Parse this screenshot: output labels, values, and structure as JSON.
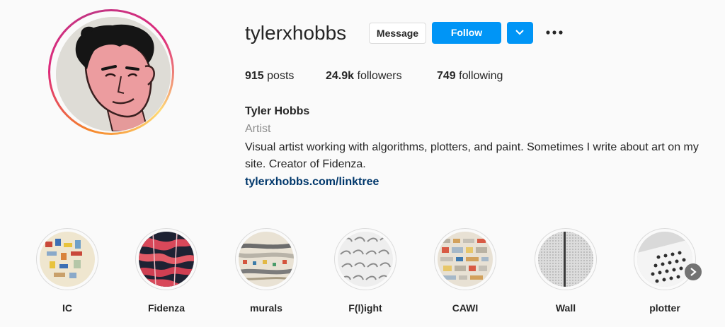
{
  "profile": {
    "username": "tylerxhobbs",
    "message_label": "Message",
    "follow_label": "Follow",
    "stats": {
      "posts_count": "915",
      "posts_label": "posts",
      "followers_count": "24.9k",
      "followers_label": "followers",
      "following_count": "749",
      "following_label": "following"
    },
    "bio": {
      "name": "Tyler Hobbs",
      "category": "Artist",
      "text": "Visual artist working with algorithms, plotters, and paint. Sometimes I write about art on my site. Creator of Fidenza.",
      "link": "tylerxhobbs.com/linktree"
    }
  },
  "highlights": [
    {
      "label": "IC"
    },
    {
      "label": "Fidenza"
    },
    {
      "label": "murals"
    },
    {
      "label": "F(l)ight"
    },
    {
      "label": "CAWI"
    },
    {
      "label": "Wall"
    },
    {
      "label": "plotter"
    }
  ],
  "icons": {
    "more": "more-options-icon",
    "dropdown": "chevron-down-icon",
    "next": "chevron-right-icon"
  },
  "colors": {
    "follow_blue": "#0095f6",
    "link": "#00376b",
    "muted": "#8e8e8e"
  }
}
